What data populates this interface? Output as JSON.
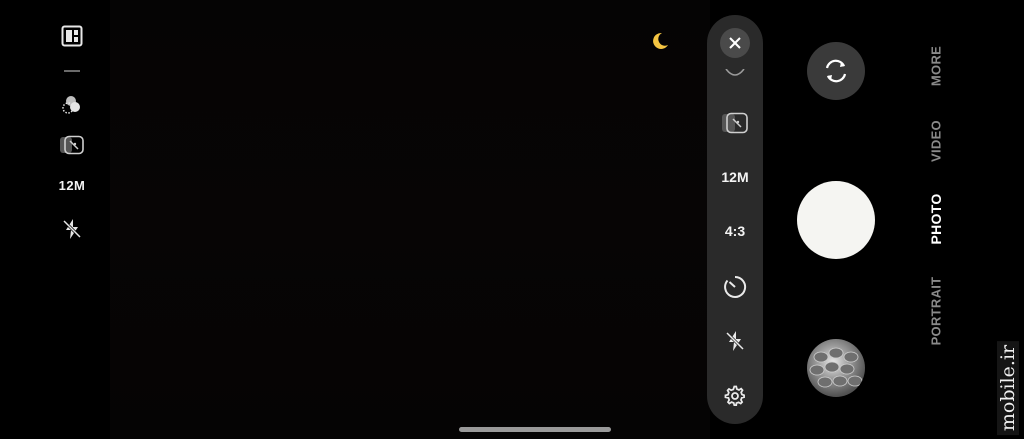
{
  "left_bar": {
    "items": [
      {
        "icon": "layout-icon"
      },
      {
        "icon": "divider"
      },
      {
        "icon": "filters-icon"
      },
      {
        "icon": "motion-photo-icon"
      },
      {
        "label": "12M"
      },
      {
        "icon": "flash-off-icon"
      }
    ]
  },
  "viewfinder": {
    "indicator_icon": "night-mode-moon-icon",
    "indicator_color": "#f5c542"
  },
  "quick_settings": {
    "close_icon": "close-icon",
    "items": [
      {
        "icon": "partial-icon"
      },
      {
        "icon": "motion-photo-icon"
      },
      {
        "label": "12M"
      },
      {
        "label": "4:3"
      },
      {
        "icon": "timer-icon"
      },
      {
        "icon": "flash-off-icon"
      },
      {
        "icon": "settings-gear-icon"
      }
    ]
  },
  "controls": {
    "switch_camera_icon": "switch-camera-icon",
    "shutter": "shutter-button",
    "gallery_thumbnail": "gallery-thumbnail"
  },
  "modes": {
    "items": [
      "MORE",
      "VIDEO",
      "PHOTO",
      "PORTRAIT"
    ],
    "active": "PHOTO"
  },
  "watermark": "mobile.ir",
  "colors": {
    "accent_moon": "#f5c542",
    "shutter": "#f5f5f2",
    "pill_bg": "#2a2a2a"
  }
}
